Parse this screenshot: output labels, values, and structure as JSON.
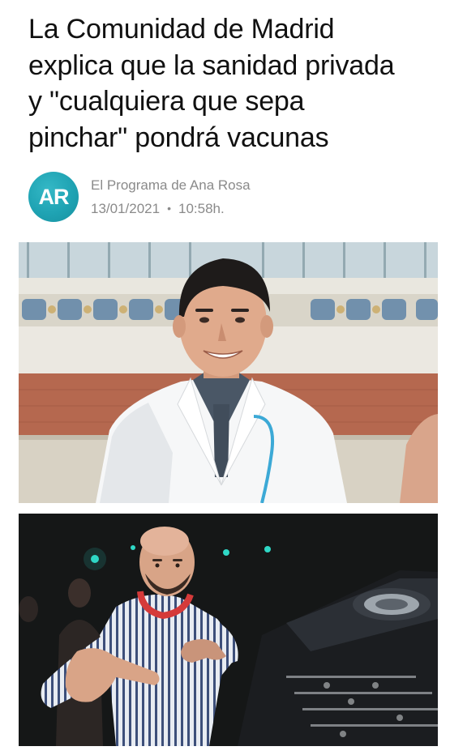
{
  "article": {
    "headline_lines": [
      "La Comunidad de Madrid",
      "explica que la sanidad privada",
      "y \"cualquiera que sepa",
      "pinchar\" pondrá vacunas"
    ],
    "source": {
      "logo_text": "AR",
      "name": "El Programa de Ana Rosa",
      "date": "13/01/2021",
      "separator": "•",
      "time": "10:58h."
    }
  },
  "colors": {
    "logo_bg": "#1fa3b3",
    "meta_text": "#8a8a8a",
    "headline_text": "#111111"
  },
  "icons": {
    "logo": "ana-rosa-logo-icon"
  }
}
